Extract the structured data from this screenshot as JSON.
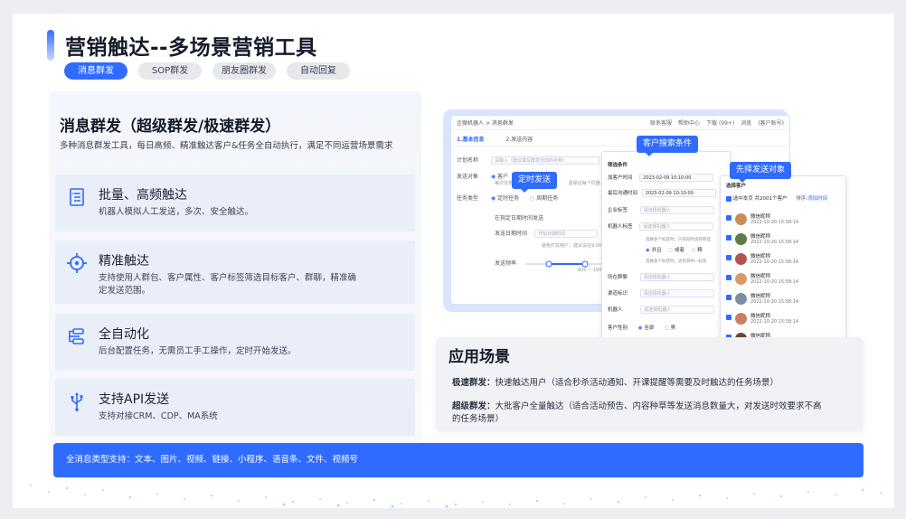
{
  "title": "营销触达--多场景营销工具",
  "tabs": [
    {
      "label": "消息群发",
      "active": true
    },
    {
      "label": "SOP群发",
      "active": false
    },
    {
      "label": "朋友圈群发",
      "active": false
    },
    {
      "label": "自动回复",
      "active": false
    }
  ],
  "section": {
    "title": "消息群发（超级群发/极速群发）",
    "desc": "多种消息群发工具，每日高频、精准触达客户&任务全自动执行，满足不同运营场景需求"
  },
  "features": [
    {
      "icon": "list-icon",
      "title": "批量、高频触达",
      "desc": "机器人模拟人工发送，多次、安全触达。"
    },
    {
      "icon": "target-icon",
      "title": "精准触达",
      "desc": "支持使用人群包、客户属性、客户标签筛选目标客户、群聊，精准确定发送范围。"
    },
    {
      "icon": "flow-icon",
      "title": "全自动化",
      "desc": "后台配置任务，无需员工手工操作，定时开始发送。"
    },
    {
      "icon": "usb-icon",
      "title": "支持API发送",
      "desc": "支持对接CRM、CDP、MA系统"
    }
  ],
  "bottom_bar": "全消息类型支持：文本、图片、视频、链接、小程序、语音条、文件、视频号",
  "app": {
    "breadcrumb": "企微机器人 > 消息群发",
    "nav": [
      "联系客服",
      "帮助中心",
      "下载 (99+)",
      "消息",
      "(客户账号)"
    ],
    "steps": [
      "1.基本信息",
      "2.发送内容"
    ],
    "plan_label": "计划名称",
    "plan_placeholder": "请输入（建议填写群发活动的名称）",
    "target_label": "发送对象",
    "target_option": "客户",
    "target_note_1": "每次任务",
    "target_note_2": "需保证每个机器人发",
    "task_label": "任务类型",
    "task_opt1": "定时任务",
    "task_opt2": "周期任务",
    "range_label": "在指定日期时间发送",
    "date_label": "发送日期时间",
    "date_placeholder": "开始日期时间",
    "date_note": "避免打扰用户，建议设在9:00~20:00发",
    "freq_label": "发送频率",
    "freq_range": "600 ~ 1600",
    "bubble_schedule": "定时发送"
  },
  "filter_panel": {
    "bubble": "客户搜索条件",
    "heading": "筛选条件",
    "add_time_label": "加客户时间",
    "add_time": "2023-02-09 10:10:00",
    "last_contact_label": "最后沟通时间",
    "last_contact": "2023-02-09 10:10:00",
    "tag_label": "企业标签",
    "robot_label": "机器人标签",
    "placeholder": "请选择机器人",
    "hint1": "选择多个标签时，只有同时含有所选",
    "opt_and": "并且",
    "opt_or": "或者",
    "opt_more": "精",
    "hint2": "选择多个标签时，含有其中一标签",
    "group_label": "所在群聊",
    "channel_label": "渠道标识",
    "robot2_label": "机器人",
    "robot2_placeholder": "请选择机器人",
    "gender_label": "客户性别",
    "gender_all": "全部",
    "gender_male": "男"
  },
  "select_panel": {
    "bubble": "先择发送对象",
    "heading": "选择客户",
    "select_page": "选中本页",
    "total": "共2001个客户",
    "sort": "排序:",
    "sort_link": "添加时间",
    "customers": [
      {
        "name": "微信昵称",
        "time": "2022-10-20 15:58:14",
        "color": "#c98d5a"
      },
      {
        "name": "微信昵称",
        "time": "2022-10-20 15:58:14",
        "color": "#5f7a48"
      },
      {
        "name": "微信昵称",
        "time": "2022-10-20 15:58:14",
        "color": "#b5534f"
      },
      {
        "name": "微信昵称",
        "time": "2022-10-20 15:58:14",
        "color": "#d69b6c"
      },
      {
        "name": "微信昵称",
        "time": "2022-10-20 15:58:14",
        "color": "#7b8f9f"
      },
      {
        "name": "微信昵称",
        "time": "2022-10-20 15:58:14",
        "color": "#c98060"
      },
      {
        "name": "微信昵称",
        "time": "",
        "color": "#6a4a3a"
      }
    ]
  },
  "apply": {
    "title": "应用场景",
    "line1_label": "极速群发：",
    "line1_text": "快速触达用户（适合秒杀活动通知、开课提醒等需要及时触达的任务场景）",
    "line2_label": "超级群发：",
    "line2_text": "大批客户全量触达（适合活动预告、内容种草等发送消息数量大，对发送时效要求不高的任务场景）"
  },
  "colors": {
    "accent": "#2f6bff",
    "panel": "#e9eef8"
  }
}
